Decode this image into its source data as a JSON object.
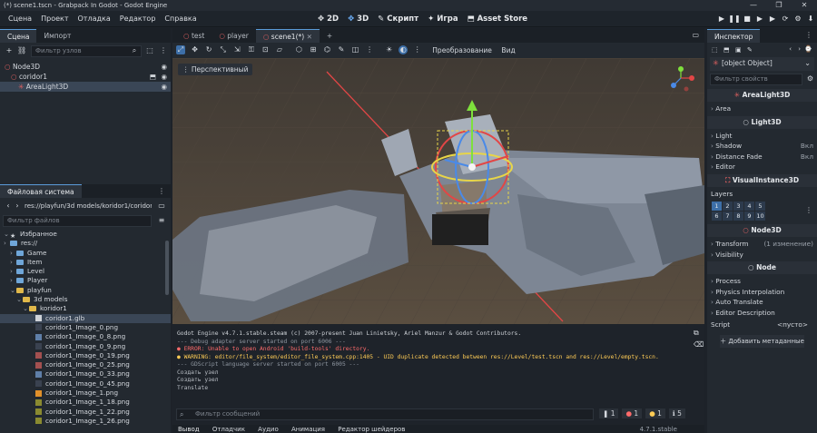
{
  "window": {
    "title": "(*) scene1.tscn - Grabpack In Godot - Godot Engine",
    "controls": [
      "—",
      "❐",
      "✕"
    ]
  },
  "menu": [
    "Сцена",
    "Проект",
    "Отладка",
    "Редактор",
    "Справка"
  ],
  "workspaces": [
    "2D",
    "3D",
    "Скрипт",
    "Игра",
    "Asset Store"
  ],
  "play_controls": [
    "▶",
    "❚❚",
    "■",
    "▶",
    "▶",
    "⟳",
    "⚙",
    "⬇"
  ],
  "scene_dock": {
    "tabs": [
      "Сцена",
      "Импорт"
    ],
    "filter_placeholder": "Фильтр узлов",
    "tree": [
      {
        "label": "Node3D",
        "depth": 0
      },
      {
        "label": "coridor1",
        "depth": 1
      },
      {
        "label": "AreaLight3D",
        "depth": 2
      }
    ]
  },
  "fs_dock": {
    "tab": "Файловая система",
    "path": "res://playfun/3d models/koridor1/coridor1.",
    "filter_placeholder": "Фильтр файлов",
    "items": [
      {
        "label": "Избранное",
        "depth": 0,
        "kind": "star"
      },
      {
        "label": "res://",
        "depth": 0,
        "kind": "folder"
      },
      {
        "label": "Game",
        "depth": 1,
        "kind": "folder"
      },
      {
        "label": "Item",
        "depth": 1,
        "kind": "folder"
      },
      {
        "label": "Level",
        "depth": 1,
        "kind": "folder"
      },
      {
        "label": "Player",
        "depth": 1,
        "kind": "folder"
      },
      {
        "label": "playfun",
        "depth": 1,
        "kind": "folder-open"
      },
      {
        "label": "3d models",
        "depth": 2,
        "kind": "folder-open"
      },
      {
        "label": "koridor1",
        "depth": 3,
        "kind": "folder-open"
      },
      {
        "label": "coridor1.glb",
        "depth": 4,
        "kind": "glb"
      },
      {
        "label": "coridor1_Image_0.png",
        "depth": 4,
        "kind": "img-dark"
      },
      {
        "label": "coridor1_Image_0_8.png",
        "depth": 4,
        "kind": "img-blue"
      },
      {
        "label": "coridor1_Image_0_9.png",
        "depth": 4,
        "kind": "img-dark"
      },
      {
        "label": "coridor1_Image_0_19.png",
        "depth": 4,
        "kind": "img-red"
      },
      {
        "label": "coridor1_Image_0_25.png",
        "depth": 4,
        "kind": "img-red"
      },
      {
        "label": "coridor1_Image_0_33.png",
        "depth": 4,
        "kind": "img-blue"
      },
      {
        "label": "coridor1_Image_0_45.png",
        "depth": 4,
        "kind": "img-dark"
      },
      {
        "label": "coridor1_Image_1.png",
        "depth": 4,
        "kind": "img-orange"
      },
      {
        "label": "coridor1_Image_1_18.png",
        "depth": 4,
        "kind": "img-olive"
      },
      {
        "label": "coridor1_Image_1_22.png",
        "depth": 4,
        "kind": "img-olive"
      },
      {
        "label": "coridor1_Image_1_26.png",
        "depth": 4,
        "kind": "img-olive"
      }
    ]
  },
  "editor_tabs": [
    {
      "label": "test",
      "icon": "○"
    },
    {
      "label": "player",
      "icon": "○"
    },
    {
      "label": "scene1(*)",
      "icon": "○"
    }
  ],
  "viewport": {
    "toolbar_labels": [
      "Преобразование",
      "Вид"
    ],
    "perspective": "Перспективный"
  },
  "console": {
    "lines": [
      {
        "text": "Godot Engine v4.7.1.stable.steam (c) 2007-present Juan Linietsky, Ariel Manzur & Godot Contributors.",
        "color": "#cfd3d8"
      },
      {
        "text": "--- Debug adapter server started on port 6006 ---",
        "color": "#8e96a0"
      },
      {
        "text": "● ERROR: Unable to open Android 'build-tools' directory.",
        "color": "#ff6b6b"
      },
      {
        "text": "● WARNING: editor/file_system/editor_file_system.cpp:1405 - UID duplicate detected between res://Level/test.tscn and res://Level/empty.tscn.",
        "color": "#ffcc55"
      },
      {
        "text": "--- GDScript language server started on port 6005 ---",
        "color": "#8e96a0"
      },
      {
        "text": "Создать узел",
        "color": "#b8bdc4"
      },
      {
        "text": "Создать узел",
        "color": "#b8bdc4"
      },
      {
        "text": "Translate",
        "color": "#b8bdc4"
      }
    ],
    "filter_placeholder": "Фильтр сообщений",
    "counts": [
      "1",
      "1",
      "1",
      "5"
    ],
    "bottom_tabs": [
      "Вывод",
      "Отладчик",
      "Аудио",
      "Анимация",
      "Редактор шейдеров"
    ],
    "version": "4.7.1.stable"
  },
  "inspector": {
    "tab": "Инспектор",
    "node": {
      "head": "Node",
      "rows": [
        {
          "label": "Process",
          "val": ""
        },
        {
          "label": "Physics Interpolation",
          "val": ""
        },
        {
          "label": "Auto Translate",
          "val": ""
        },
        {
          "label": "Editor Description",
          "val": ""
        }
      ]
    },
    "filter_placeholder": "Фильтр свойств",
    "sections": [
      {
        "head": "AreaLight3D",
        "rows": [
          {
            "label": "Area",
            "val": ""
          }
        ]
      },
      {
        "head": "Light3D",
        "rows": [
          {
            "label": "Light",
            "val": ""
          },
          {
            "label": "Shadow",
            "val": "Вкл"
          },
          {
            "label": "Distance Fade",
            "val": "Вкл"
          },
          {
            "label": "Editor",
            "val": ""
          }
        ]
      },
      {
        "head": "VisualInstance3D",
        "rows": [
          {
            "label": "Layers",
            "val": ""
          }
        ]
      }
    ],
    "layers": [
      "1",
      "2",
      "3",
      "4",
      "5",
      "6",
      "7",
      "8",
      "9",
      "10"
    ],
    "node3d": {
      "head": "Node3D",
      "rows": [
        {
          "label": "Transform",
          "val": "(1 изменение)"
        },
        {
          "label": "Visibility",
          "val": ""
        }
      ]
    },
    "script_label": "Script",
    "script_value": "<пусто>",
    "add_meta": "Добавить метаданные"
  },
  "colors": {
    "accent": "#5a9bd8",
    "selection": "#3a4656"
  }
}
